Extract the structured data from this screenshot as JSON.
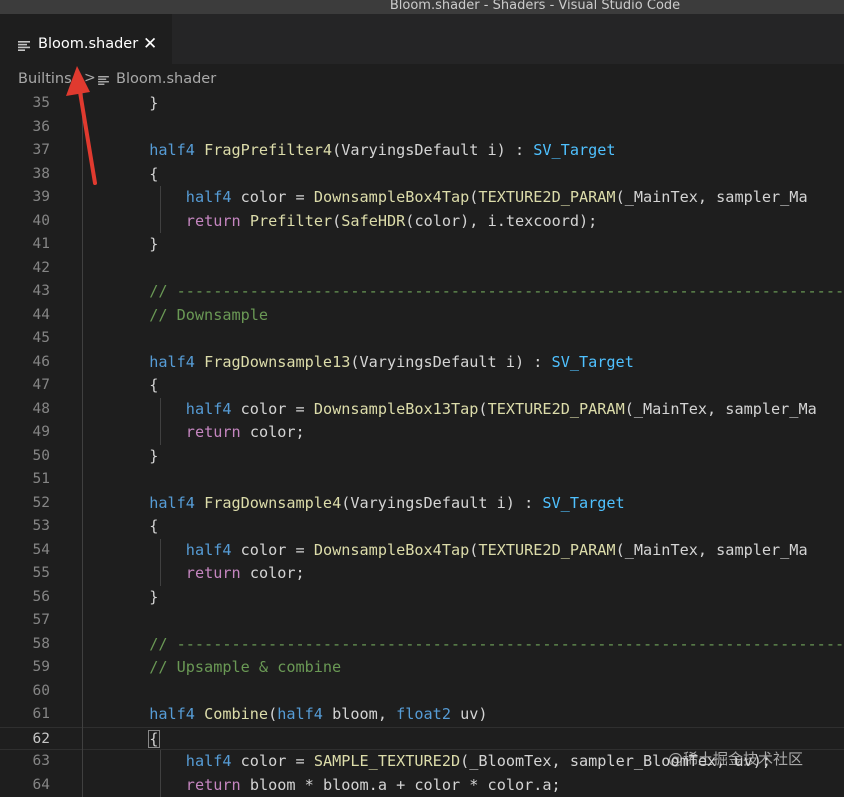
{
  "window": {
    "title": "Bloom.shader - Shaders - Visual Studio Code"
  },
  "tab": {
    "label": "Bloom.shader",
    "close_glyph": "✕",
    "icon": "file-lines-icon"
  },
  "breadcrumb": {
    "folder": "Builtins",
    "separator": ">",
    "file": "Bloom.shader",
    "file_icon": "file-lines-icon"
  },
  "editor": {
    "current_line": 62,
    "lines": [
      {
        "n": "35",
        "i": 2,
        "t": [
          [
            "}",
            "p"
          ]
        ]
      },
      {
        "n": "36",
        "i": 0,
        "t": []
      },
      {
        "n": "37",
        "i": 2,
        "t": [
          [
            "half4",
            "k"
          ],
          [
            " ",
            "p"
          ],
          [
            "FragPrefilter4",
            "f"
          ],
          [
            "(VaryingsDefault i) : ",
            "p"
          ],
          [
            "SV_Target",
            "c"
          ]
        ]
      },
      {
        "n": "38",
        "i": 2,
        "t": [
          [
            "{",
            "p"
          ]
        ]
      },
      {
        "n": "39",
        "i": 3,
        "t": [
          [
            "half4",
            "k"
          ],
          [
            " color = ",
            "p"
          ],
          [
            "DownsampleBox4Tap",
            "f"
          ],
          [
            "(",
            "p"
          ],
          [
            "TEXTURE2D_PARAM",
            "f"
          ],
          [
            "(_MainTex, sampler_Ma",
            "p"
          ]
        ]
      },
      {
        "n": "40",
        "i": 3,
        "t": [
          [
            "return",
            "r"
          ],
          [
            " ",
            "p"
          ],
          [
            "Prefilter",
            "f"
          ],
          [
            "(",
            "p"
          ],
          [
            "SafeHDR",
            "f"
          ],
          [
            "(color), i.texcoord);",
            "p"
          ]
        ]
      },
      {
        "n": "41",
        "i": 2,
        "t": [
          [
            "}",
            "p"
          ]
        ]
      },
      {
        "n": "42",
        "i": 0,
        "t": []
      },
      {
        "n": "43",
        "i": 2,
        "t": [
          [
            "// ----------------------------------------------------------------------------",
            "m"
          ]
        ]
      },
      {
        "n": "44",
        "i": 2,
        "t": [
          [
            "// Downsample",
            "m"
          ]
        ]
      },
      {
        "n": "45",
        "i": 0,
        "t": []
      },
      {
        "n": "46",
        "i": 2,
        "t": [
          [
            "half4",
            "k"
          ],
          [
            " ",
            "p"
          ],
          [
            "FragDownsample13",
            "f"
          ],
          [
            "(VaryingsDefault i) : ",
            "p"
          ],
          [
            "SV_Target",
            "c"
          ]
        ]
      },
      {
        "n": "47",
        "i": 2,
        "t": [
          [
            "{",
            "p"
          ]
        ]
      },
      {
        "n": "48",
        "i": 3,
        "t": [
          [
            "half4",
            "k"
          ],
          [
            " color = ",
            "p"
          ],
          [
            "DownsampleBox13Tap",
            "f"
          ],
          [
            "(",
            "p"
          ],
          [
            "TEXTURE2D_PARAM",
            "f"
          ],
          [
            "(_MainTex, sampler_Ma",
            "p"
          ]
        ]
      },
      {
        "n": "49",
        "i": 3,
        "t": [
          [
            "return",
            "r"
          ],
          [
            " color;",
            "p"
          ]
        ]
      },
      {
        "n": "50",
        "i": 2,
        "t": [
          [
            "}",
            "p"
          ]
        ]
      },
      {
        "n": "51",
        "i": 0,
        "t": []
      },
      {
        "n": "52",
        "i": 2,
        "t": [
          [
            "half4",
            "k"
          ],
          [
            " ",
            "p"
          ],
          [
            "FragDownsample4",
            "f"
          ],
          [
            "(VaryingsDefault i) : ",
            "p"
          ],
          [
            "SV_Target",
            "c"
          ]
        ]
      },
      {
        "n": "53",
        "i": 2,
        "t": [
          [
            "{",
            "p"
          ]
        ]
      },
      {
        "n": "54",
        "i": 3,
        "t": [
          [
            "half4",
            "k"
          ],
          [
            " color = ",
            "p"
          ],
          [
            "DownsampleBox4Tap",
            "f"
          ],
          [
            "(",
            "p"
          ],
          [
            "TEXTURE2D_PARAM",
            "f"
          ],
          [
            "(_MainTex, sampler_Ma",
            "p"
          ]
        ]
      },
      {
        "n": "55",
        "i": 3,
        "t": [
          [
            "return",
            "r"
          ],
          [
            " color;",
            "p"
          ]
        ]
      },
      {
        "n": "56",
        "i": 2,
        "t": [
          [
            "}",
            "p"
          ]
        ]
      },
      {
        "n": "57",
        "i": 0,
        "t": []
      },
      {
        "n": "58",
        "i": 2,
        "t": [
          [
            "// ----------------------------------------------------------------------------",
            "m"
          ]
        ]
      },
      {
        "n": "59",
        "i": 2,
        "t": [
          [
            "// Upsample & combine",
            "m"
          ]
        ]
      },
      {
        "n": "60",
        "i": 0,
        "t": []
      },
      {
        "n": "61",
        "i": 2,
        "t": [
          [
            "half4",
            "k"
          ],
          [
            " ",
            "p"
          ],
          [
            "Combine",
            "f"
          ],
          [
            "(",
            "p"
          ],
          [
            "half4",
            "k"
          ],
          [
            " bloom, ",
            "p"
          ],
          [
            "float2",
            "k"
          ],
          [
            " uv)",
            "p"
          ]
        ]
      },
      {
        "n": "62",
        "i": 2,
        "t": [
          [
            "{",
            "p"
          ]
        ]
      },
      {
        "n": "63",
        "i": 3,
        "t": [
          [
            "half4",
            "k"
          ],
          [
            " color = ",
            "p"
          ],
          [
            "SAMPLE_TEXTURE2D",
            "f"
          ],
          [
            "(_BloomTex, sampler_BloomTex, uv);",
            "p"
          ]
        ]
      },
      {
        "n": "64",
        "i": 3,
        "t": [
          [
            "return",
            "r"
          ],
          [
            " bloom * bloom.a + color * color.a;",
            "p"
          ]
        ]
      }
    ]
  },
  "syntax_colors": {
    "k": "#569cd6",
    "c": "#4fc1ff",
    "f": "#dcdcaa",
    "r": "#c586c0",
    "m": "#6a9955",
    "p": "#d4d4d4"
  },
  "watermark": {
    "text": "@稀土掘金技术社区"
  },
  "annotation": {
    "arrow_color": "#e03a2f"
  }
}
